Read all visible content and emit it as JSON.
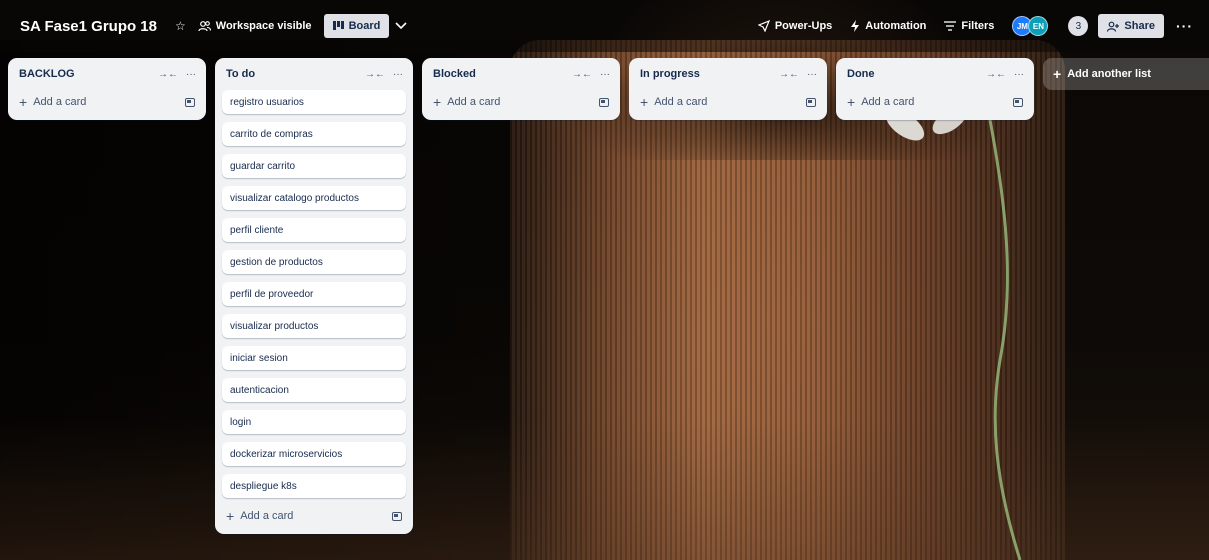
{
  "header": {
    "board_title": "SA Fase1 Grupo 18",
    "visibility_label": "Workspace visible",
    "view_label": "Board",
    "power_ups_label": "Power-Ups",
    "automation_label": "Automation",
    "filters_label": "Filters",
    "members": [
      {
        "initials": "JM",
        "color": "#1d7afc"
      },
      {
        "initials": "EN",
        "color": "#0c9fb8"
      }
    ],
    "member_count": "3",
    "share_label": "Share",
    "more_label": "···"
  },
  "lists": [
    {
      "title": "BACKLOG",
      "cards": [],
      "add_card_label": "Add a card"
    },
    {
      "title": "To do",
      "cards": [
        "registro usuarios",
        "carrito de compras",
        "guardar carrito",
        "visualizar catalogo productos",
        "perfil cliente",
        "gestion de productos",
        "perfil de proveedor",
        "visualizar productos",
        "iniciar sesion",
        "autenticacion",
        "login",
        "dockerizar microservicios",
        "despliegue k8s"
      ],
      "add_card_label": "Add a card"
    },
    {
      "title": "Blocked",
      "cards": [],
      "add_card_label": "Add a card"
    },
    {
      "title": "In progress",
      "cards": [],
      "add_card_label": "Add a card"
    },
    {
      "title": "Done",
      "cards": [],
      "add_card_label": "Add a card"
    }
  ],
  "add_list_label": "Add another list",
  "icons": {
    "star": "star-icon",
    "visibility": "people-icon",
    "board_view": "board-icon",
    "chevron": "chevron-down-icon",
    "power_ups": "rocket-icon",
    "automation": "bolt-icon",
    "filters": "filter-icon",
    "share": "add-person-icon",
    "collapse": "collapse-arrows-icon",
    "list_menu": "ellipsis-icon",
    "template": "template-icon"
  }
}
